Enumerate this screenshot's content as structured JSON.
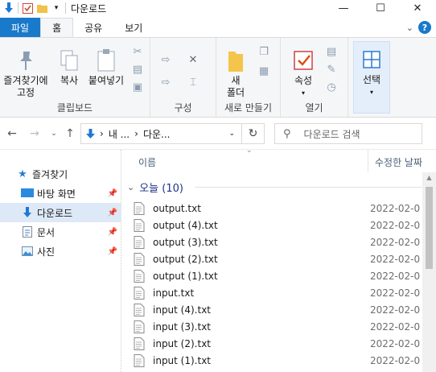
{
  "window": {
    "title": "다운로드",
    "minimize": "—",
    "maximize": "☐",
    "close": "✕"
  },
  "ribbon_tabs": {
    "file": "파일",
    "home": "홈",
    "share": "공유",
    "view": "보기"
  },
  "ribbon": {
    "clipboard": {
      "pin_label_1": "즐겨찾기에",
      "pin_label_2": "고정",
      "copy": "복사",
      "paste": "붙여넣기",
      "group": "클립보드"
    },
    "organize": {
      "group": "구성"
    },
    "new": {
      "folder_1": "새",
      "folder_2": "폴더",
      "group": "새로 만들기"
    },
    "open": {
      "properties": "속성",
      "group": "열기"
    },
    "select": {
      "label": "선택"
    }
  },
  "address": {
    "crumb1": "내 ...",
    "crumb2": "다운...",
    "search_placeholder": "다운로드 검색"
  },
  "nav": {
    "quick_access": "즐겨찾기",
    "items": [
      {
        "label": "바탕 화면",
        "pinned": true
      },
      {
        "label": "다운로드",
        "pinned": true
      },
      {
        "label": "문서",
        "pinned": true
      },
      {
        "label": "사진",
        "pinned": true
      }
    ]
  },
  "columns": {
    "name": "이름",
    "date_modified": "수정한 날짜"
  },
  "group": {
    "label": "오늘 (10)"
  },
  "files": [
    {
      "name": "output.txt",
      "date": "2022-02-0"
    },
    {
      "name": "output (4).txt",
      "date": "2022-02-0"
    },
    {
      "name": "output (3).txt",
      "date": "2022-02-0"
    },
    {
      "name": "output (2).txt",
      "date": "2022-02-0"
    },
    {
      "name": "output (1).txt",
      "date": "2022-02-0"
    },
    {
      "name": "input.txt",
      "date": "2022-02-0"
    },
    {
      "name": "input (4).txt",
      "date": "2022-02-0"
    },
    {
      "name": "input (3).txt",
      "date": "2022-02-0"
    },
    {
      "name": "input (2).txt",
      "date": "2022-02-0"
    },
    {
      "name": "input (1).txt",
      "date": "2022-02-0"
    }
  ]
}
